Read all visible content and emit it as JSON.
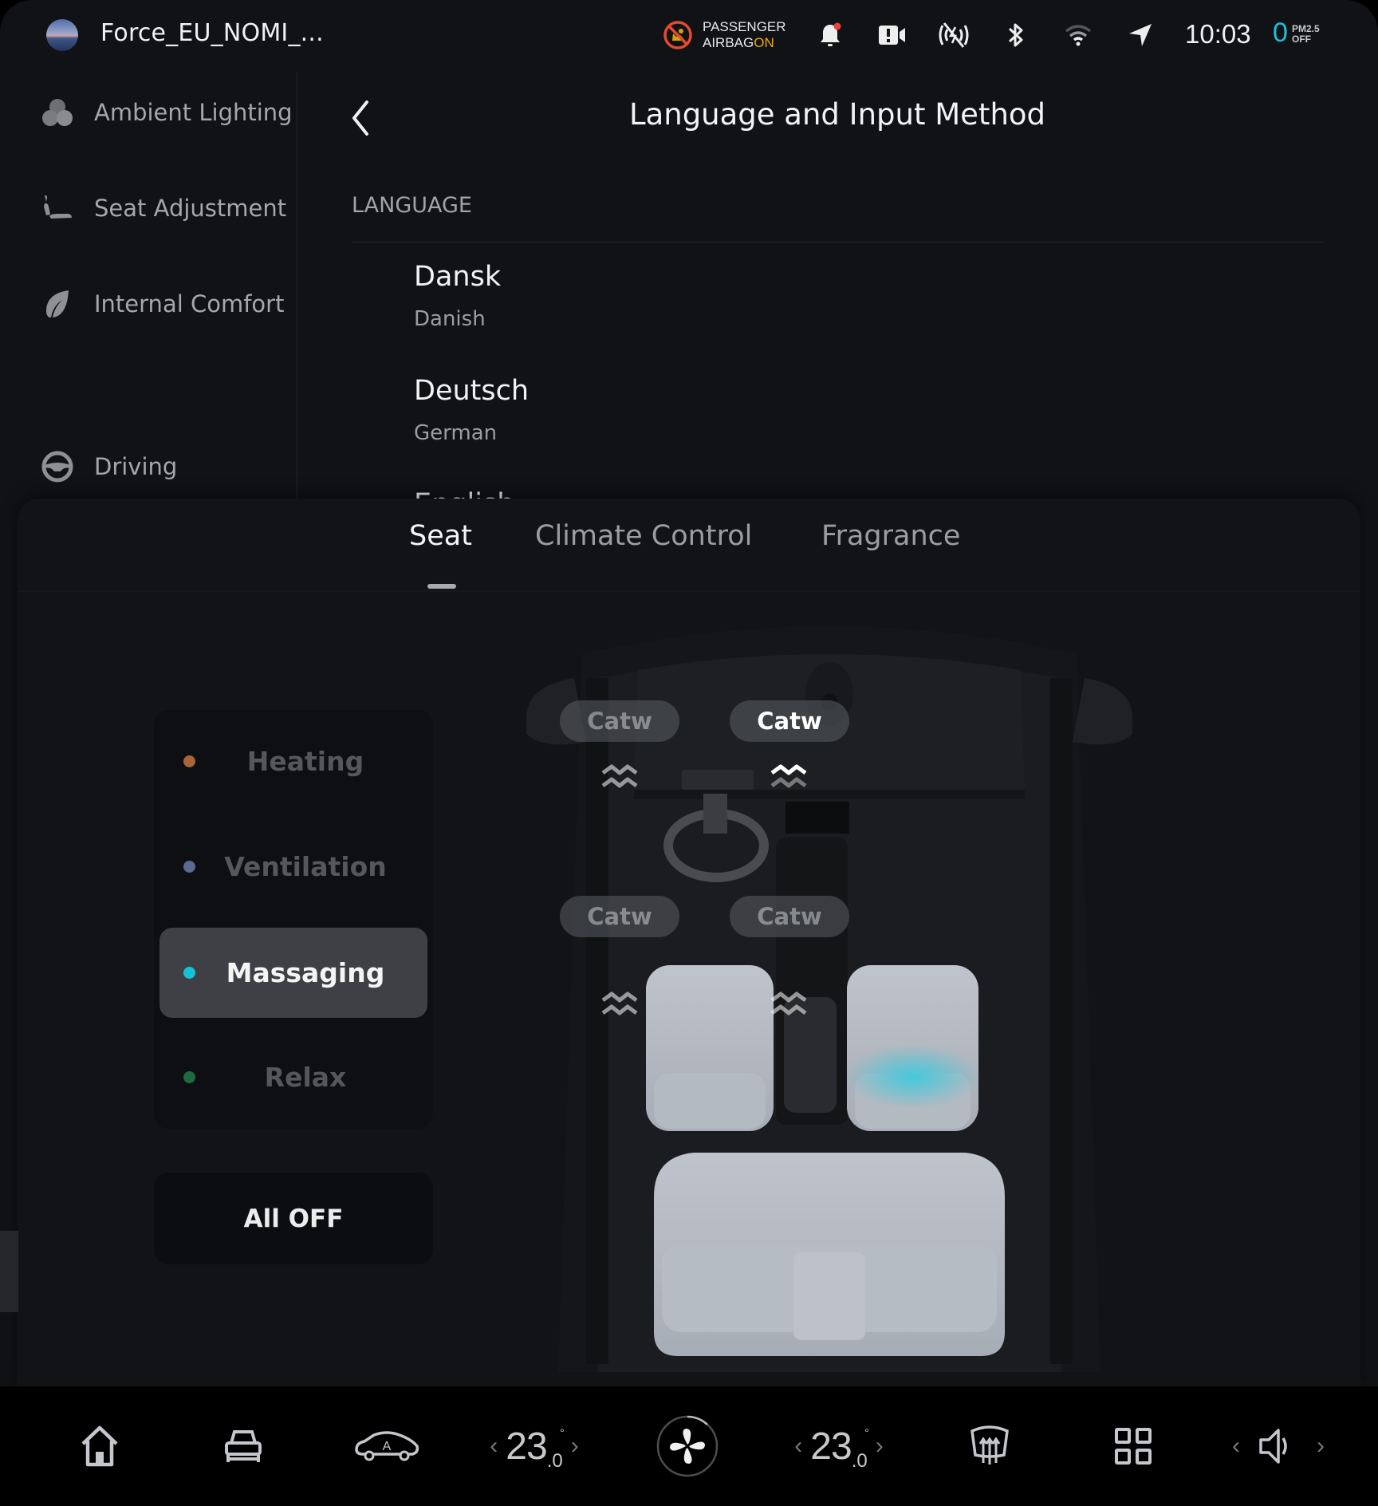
{
  "status_bar": {
    "profile_name": "Force_EU_NOMI_...",
    "airbag_line1": "PASSENGER",
    "airbag_line2": "AIRBAG",
    "airbag_state": "ON",
    "time": "10:03",
    "pm25_value": "0",
    "pm25_label": "PM2.5",
    "pm25_state": "OFF",
    "icons": [
      "airbag-off-icon",
      "notification-bell-icon",
      "camera-alert-icon",
      "no-signal-icon",
      "bluetooth-icon",
      "wifi-icon",
      "navigation-icon"
    ],
    "colors": {
      "airbag_on": "#f2a900",
      "pm_value": "#1ec0d8",
      "notification_dot": "#e8433a"
    }
  },
  "sidebar": {
    "items": [
      {
        "label": "Ambient Lighting",
        "icon": "ambient-lighting-icon"
      },
      {
        "label": "Seat Adjustment",
        "icon": "seat-icon"
      },
      {
        "label": "Internal Comfort",
        "icon": "leaf-icon"
      },
      {
        "label": "Driving",
        "icon": "steering-wheel-icon"
      }
    ]
  },
  "language_page": {
    "title": "Language and Input Method",
    "section_label": "LANGUAGE",
    "languages": [
      {
        "native": "Dansk",
        "english": "Danish"
      },
      {
        "native": "Deutsch",
        "english": "German"
      },
      {
        "native": "English",
        "english": ""
      }
    ]
  },
  "comfort_sheet": {
    "tabs": [
      {
        "label": "Seat",
        "active": true
      },
      {
        "label": "Climate Control",
        "active": false
      },
      {
        "label": "Fragrance",
        "active": false
      }
    ],
    "modes": [
      {
        "label": "Heating",
        "color": "#a8643a",
        "active": false
      },
      {
        "label": "Ventilation",
        "color": "#5a6a91",
        "active": false
      },
      {
        "label": "Massaging",
        "color": "#14c3d6",
        "active": true
      },
      {
        "label": "Relax",
        "color": "#1c6b43",
        "active": false
      }
    ],
    "all_off_label": "All OFF",
    "seats": [
      {
        "position": "front-left",
        "label": "Catw",
        "active": false,
        "massage_level": 0
      },
      {
        "position": "front-right",
        "label": "Catw",
        "active": true,
        "massage_level": 1
      },
      {
        "position": "rear-left",
        "label": "Catw",
        "active": false,
        "massage_level": 0
      },
      {
        "position": "rear-right",
        "label": "Catw",
        "active": false,
        "massage_level": 0
      }
    ],
    "active_color": "#3fc9dd"
  },
  "dock": {
    "driver_temp_whole": "23",
    "driver_temp_decimal": ".0",
    "passenger_temp_whole": "23",
    "passenger_temp_decimal": ".0",
    "degree": "°",
    "left_arrow": "‹",
    "right_arrow": "›",
    "icons": [
      "home-icon",
      "car-front-icon",
      "auto-car-icon",
      "fan-icon",
      "rear-defrost-icon",
      "apps-grid-icon",
      "volume-icon"
    ]
  }
}
